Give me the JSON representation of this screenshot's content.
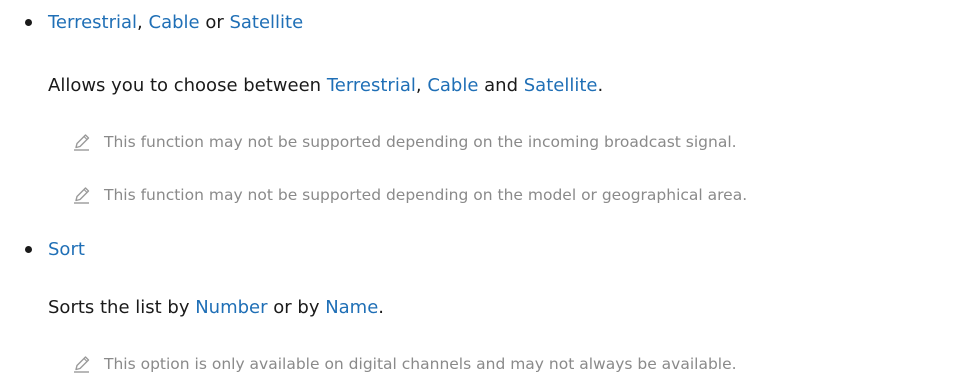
{
  "colors": {
    "keyword": "#1f6fb6",
    "body_text": "#1a1a1a",
    "note_text": "#8a8a8a"
  },
  "section1": {
    "title_kw1": "Terrestrial",
    "title_sep1": ", ",
    "title_kw2": "Cable",
    "title_sep2": " or ",
    "title_kw3": "Satellite",
    "desc_prefix": "Allows you to choose between ",
    "desc_kw1": "Terrestrial",
    "desc_sep1": ", ",
    "desc_kw2": "Cable",
    "desc_sep2": " and ",
    "desc_kw3": "Satellite",
    "desc_suffix": ".",
    "note1": "This function may not be supported depending on the incoming broadcast signal.",
    "note2": "This function may not be supported depending on the model or geographical area.",
    "note_icon": "pencil-note-icon"
  },
  "section2": {
    "title_kw": "Sort",
    "desc_prefix": "Sorts the list by ",
    "desc_kw1": "Number",
    "desc_sep": " or by ",
    "desc_kw2": "Name",
    "desc_suffix": ".",
    "note1": "This option is only available on digital channels and may not always be available.",
    "note_icon": "pencil-note-icon"
  }
}
